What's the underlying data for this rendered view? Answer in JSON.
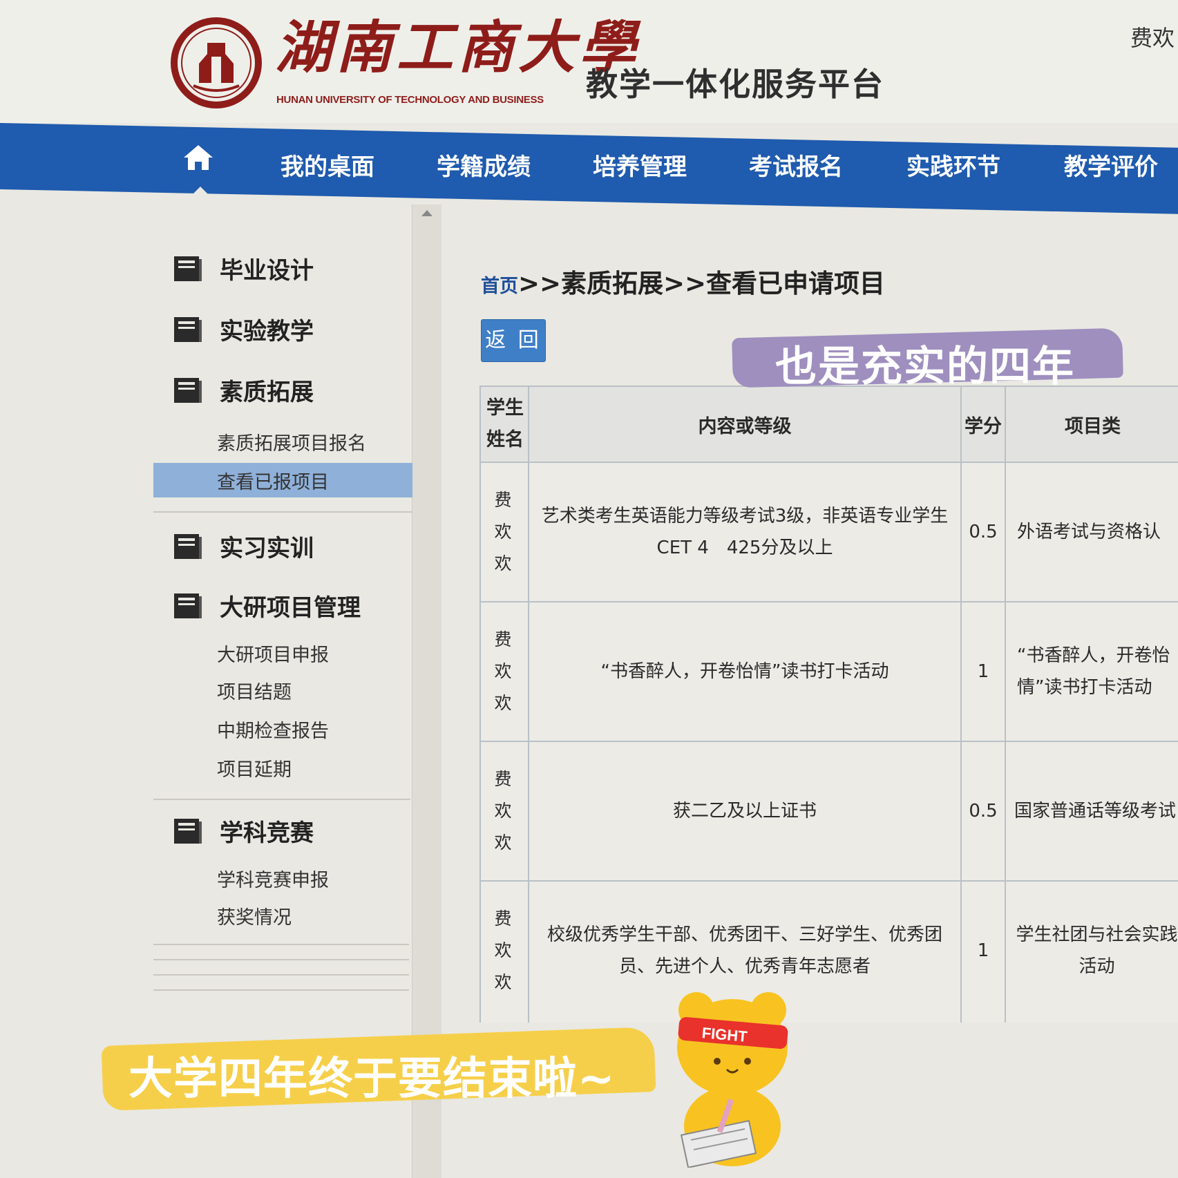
{
  "header": {
    "logo_cn": "湖南工商大學",
    "logo_en": "HUNAN UNIVERSITY OF TECHNOLOGY AND BUSINESS",
    "platform_title": "教学一体化服务平台",
    "user_name": "费欢"
  },
  "nav": {
    "home_icon": "home-icon",
    "items": [
      "我的桌面",
      "学籍成绩",
      "培养管理",
      "考试报名",
      "实践环节",
      "教学评价"
    ]
  },
  "sidebar": {
    "sections": [
      {
        "label": "毕业设计",
        "icon": "book-icon"
      },
      {
        "label": "实验教学",
        "icon": "book-icon"
      },
      {
        "label": "素质拓展",
        "icon": "book-icon",
        "subs": [
          "素质拓展项目报名",
          "查看已报项目"
        ]
      },
      {
        "label": "实习实训",
        "icon": "book-icon"
      },
      {
        "label": "大研项目管理",
        "icon": "book-icon",
        "subs": [
          "大研项目申报",
          "项目结题",
          "中期检查报告",
          "项目延期"
        ]
      },
      {
        "label": "学科竞赛",
        "icon": "book-icon",
        "subs": [
          "学科竞赛申报",
          "获奖情况"
        ]
      }
    ],
    "active_sub": "查看已报项目"
  },
  "breadcrumb": {
    "home": "首页",
    "rest": ">>素质拓展>>查看已申请项目"
  },
  "back_button": "返 回",
  "table": {
    "headers": [
      "学生姓名",
      "内容或等级",
      "学分",
      "项目类"
    ],
    "rows": [
      {
        "name": "费欢欢",
        "content": "艺术类考生英语能力等级考试3级，非英语专业学生CET 4　425分及以上",
        "credit": "0.5",
        "category": "外语考试与资格认"
      },
      {
        "name": "费欢欢",
        "content": "“书香醉人，开卷怡情”读书打卡活动",
        "credit": "1",
        "category": "“书香醉人，开卷怡情”读书打卡活动"
      },
      {
        "name": "费欢欢",
        "content": "获二乙及以上证书",
        "credit": "0.5",
        "category": "国家普通话等级考试"
      },
      {
        "name": "费欢欢",
        "content": "校级优秀学生干部、优秀团干、三好学生、优秀团员、先进个人、优秀青年志愿者",
        "credit": "1",
        "category": "学生社团与社会实践活动"
      }
    ]
  },
  "overlays": {
    "top_caption": "也是充实的四年",
    "bottom_caption": "大学四年终于要结束啦~",
    "bear_band": "FIGHT"
  },
  "colors": {
    "nav_blue": "#1f5bae",
    "brand_red": "#8e1d1a",
    "active_blue": "#8fb0d8",
    "button_blue": "#3f7fc7"
  }
}
